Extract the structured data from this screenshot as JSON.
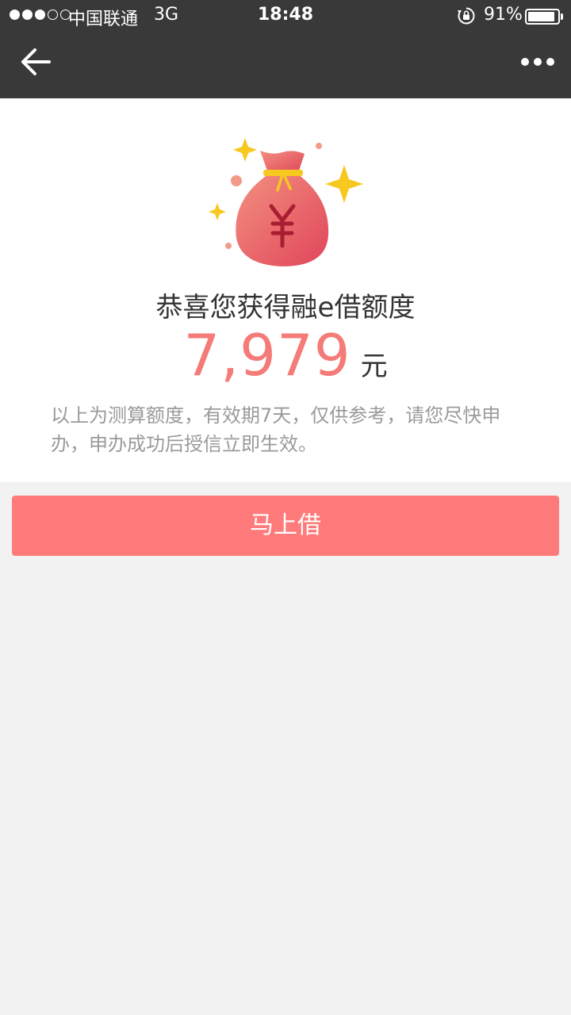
{
  "status_bar": {
    "signal_bars_filled": 3,
    "signal_bars_total": 5,
    "carrier": "中国联通",
    "network": "3G",
    "time": "18:48",
    "battery_percent_text": "91%",
    "battery_level": 0.91
  },
  "nav": {
    "back_icon": "back-arrow-icon",
    "more_icon": "more-dots-icon"
  },
  "result": {
    "title": "恭喜您获得融e借额度",
    "amount": "7,979",
    "unit": "元",
    "note": "以上为测算额度，有效期7天，仅供参考，请您尽快申办，申办成功后授信立即生效。"
  },
  "action": {
    "borrow_label": "马上借"
  },
  "colors": {
    "topbar": "#393939",
    "amount": "#f47b78",
    "button": "#ff7b7b",
    "page_bg": "#f2f2f2"
  }
}
